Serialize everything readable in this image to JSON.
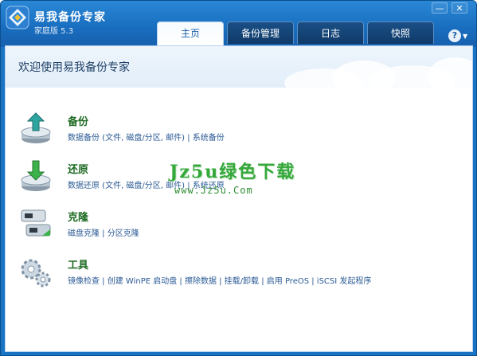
{
  "app": {
    "title": "易我备份专家",
    "version": "家庭版 5.3"
  },
  "window_controls": {
    "minimize": "—",
    "close": "✕"
  },
  "tabs": [
    {
      "label": "主页",
      "active": true
    },
    {
      "label": "备份管理",
      "active": false
    },
    {
      "label": "日志",
      "active": false
    },
    {
      "label": "快照",
      "active": false
    }
  ],
  "help": {
    "label": "?",
    "arrow": "▼"
  },
  "welcome": "欢迎使用易我备份专家",
  "features": [
    {
      "title": "备份",
      "desc": "数据备份 (文件, 磁盘/分区, 邮件) | 系统备份",
      "icon": "backup-disk-icon"
    },
    {
      "title": "还原",
      "desc": "数据还原 (文件, 磁盘/分区, 邮件) | 系统还原",
      "icon": "restore-disk-icon"
    },
    {
      "title": "克隆",
      "desc": "磁盘克隆 | 分区克隆",
      "icon": "clone-disk-icon"
    },
    {
      "title": "工具",
      "desc": "镜像检查 | 创建 WinPE 启动盘 | 擦除数据 | 挂载/卸载 | 启用 PreOS | iSCSI  发起程序",
      "icon": "tools-gears-icon"
    }
  ],
  "watermark": {
    "text": "Jz5u绿色下载",
    "url": "www.Jz5u.Com"
  },
  "colors": {
    "titlebar": "#1a74c4",
    "feature_title": "#1d6a22",
    "feature_desc": "#2a5a95"
  }
}
